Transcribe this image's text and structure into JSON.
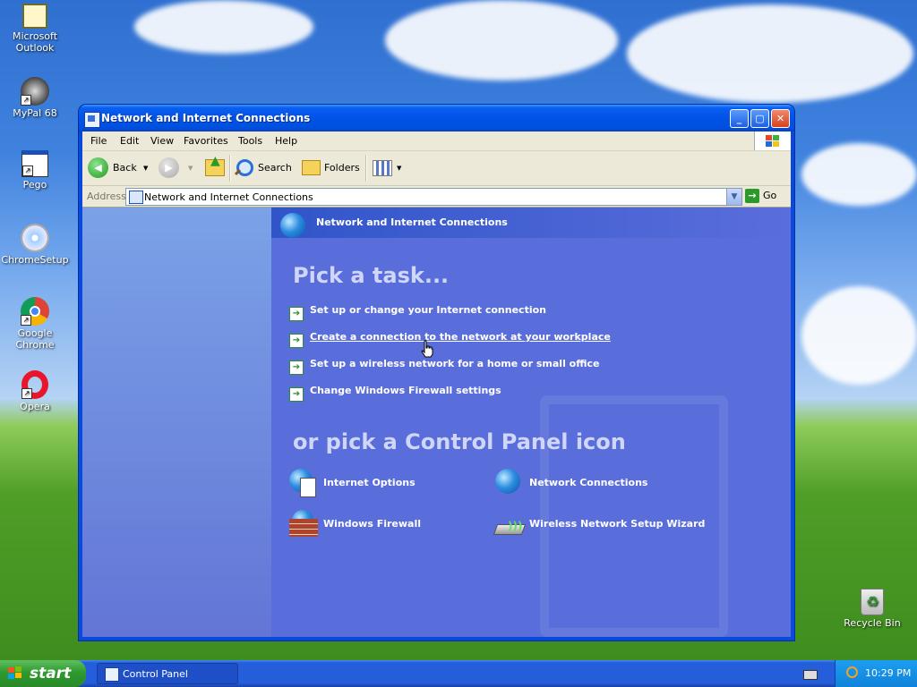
{
  "desktop": {
    "icons": [
      {
        "label": "Microsoft Outlook"
      },
      {
        "label": "MyPal 68"
      },
      {
        "label": "Pego"
      },
      {
        "label": "ChromeSetup"
      },
      {
        "label": "Google Chrome"
      },
      {
        "label": "Opera"
      },
      {
        "label": "Recycle Bin"
      }
    ]
  },
  "window": {
    "title": "Network and Internet Connections",
    "menu": [
      "File",
      "Edit",
      "View",
      "Favorites",
      "Tools",
      "Help"
    ],
    "toolbar": {
      "back": "Back",
      "search": "Search",
      "folders": "Folders"
    },
    "address": {
      "label": "Address",
      "value": "Network and Internet Connections",
      "go": "Go"
    },
    "content": {
      "header": "Network and Internet Connections",
      "pick_task": "Pick a task...",
      "tasks": [
        "Set up or change your Internet connection",
        "Create a connection to the network at your workplace",
        "Set up a wireless network for a home or small office",
        "Change Windows Firewall settings"
      ],
      "pick_icon": "or pick a Control Panel icon",
      "icons": [
        {
          "label": "Internet Options",
          "icon": "internet-options-icon"
        },
        {
          "label": "Network Connections",
          "icon": "network-connections-icon"
        },
        {
          "label": "Windows Firewall",
          "icon": "firewall-icon"
        },
        {
          "label": "Wireless Network Setup Wizard",
          "icon": "wireless-setup-icon"
        }
      ]
    }
  },
  "taskbar": {
    "start": "start",
    "active_task": "Control Panel",
    "clock": "10:29 PM"
  }
}
